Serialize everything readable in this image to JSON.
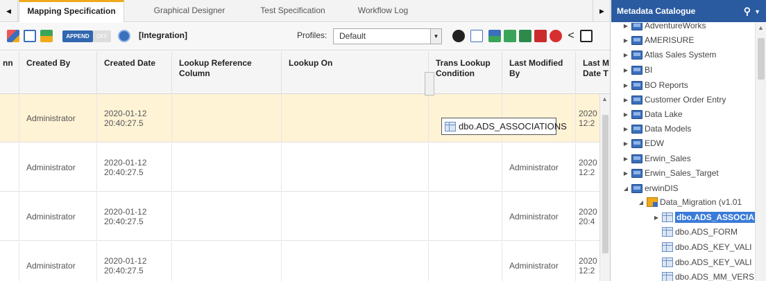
{
  "tabs": [
    {
      "label": "Mapping Specification",
      "active": true
    },
    {
      "label": "Graphical Designer",
      "active": false
    },
    {
      "label": "Test Specification",
      "active": false
    },
    {
      "label": "Workflow Log",
      "active": false
    }
  ],
  "toolbar": {
    "append_label": "APPEND",
    "off_label": "OFF",
    "integration_label": "[Integration]",
    "profiles_label": "Profiles:",
    "profile_value": "Default"
  },
  "grid": {
    "columns": [
      "nn",
      "Created By",
      "Created Date",
      "Lookup Reference Column",
      "Lookup On",
      "Trans Lookup Condition",
      "Last Modified By",
      "Last M Date T"
    ],
    "rows": [
      {
        "created_by": "Administrator",
        "created_date": "2020-01-12 20:40:27.5",
        "last_modified_by": "",
        "last_modified_date": "2020 12:2"
      },
      {
        "created_by": "Administrator",
        "created_date": "2020-01-12 20:40:27.5",
        "last_modified_by": "Administrator",
        "last_modified_date": "2020 12:2"
      },
      {
        "created_by": "Administrator",
        "created_date": "2020-01-12 20:40:27.5",
        "last_modified_by": "Administrator",
        "last_modified_date": "2020 20:4"
      },
      {
        "created_by": "Administrator",
        "created_date": "2020-01-12 20:40:27.5",
        "last_modified_by": "Administrator",
        "last_modified_date": "2020 12:2"
      }
    ],
    "drag_item": "dbo.ADS_ASSOCIATIONS"
  },
  "catalogue": {
    "title": "Metadata Catalogue",
    "items": [
      "AdventureWorks",
      "AMERISURE",
      "Atlas Sales System",
      "BI",
      "BO Reports",
      "Customer Order Entry",
      "Data Lake",
      "Data Models",
      "EDW",
      "Erwin_Sales",
      "Erwin_Sales_Target",
      "erwinDIS"
    ],
    "child_model": "Data_Migration (v1.01",
    "tables": [
      "dbo.ADS_ASSOCIA",
      "dbo.ADS_FORM",
      "dbo.ADS_KEY_VALI",
      "dbo.ADS_KEY_VALI",
      "dbo.ADS_MM_VERS"
    ]
  }
}
